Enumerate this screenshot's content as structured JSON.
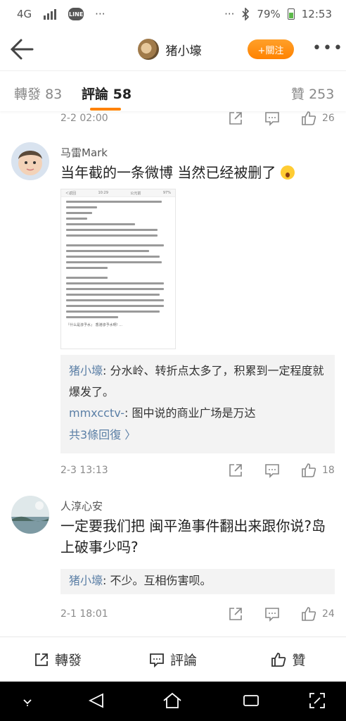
{
  "status_bar": {
    "network": "4G",
    "battery": "79%",
    "time": "12:53",
    "app_badge": "LINE",
    "more_dots": "···"
  },
  "header": {
    "title": "猪小壕",
    "follow_label": "+關注"
  },
  "tabs": [
    {
      "label": "轉發",
      "count": "83"
    },
    {
      "label": "評論",
      "count": "58"
    },
    {
      "label": "贊",
      "count": "253"
    }
  ],
  "top_meta": {
    "time": "2-2 02:00",
    "likes": "26"
  },
  "comments": [
    {
      "user": "马雷Mark",
      "text": "当年截的一条微博 当然已经被删了",
      "image": {
        "back_label": "＜返回",
        "account": "公元前",
        "clock": "10:29",
        "battery": "97%",
        "footer": "『什么是渗予水』 香港渗予水啊!  ..."
      },
      "replies": [
        {
          "name": "猪小壕",
          "text": ": 分水岭、转折点太多了，积累到一定程度就爆发了。"
        },
        {
          "name": "mmxcctv-",
          "text": ": 图中说的商业广场是万达"
        }
      ],
      "more_replies": "共3條回復 〉",
      "time": "2-3 13:13",
      "likes": "18"
    },
    {
      "user": "人淳心安",
      "text": "一定要我们把 闽平渔事件翻出来跟你说?岛上破事少吗?",
      "replies": [
        {
          "name": "猪小壕",
          "text": ": 不少。互相伤害呗。"
        }
      ],
      "time": "2-1 18:01",
      "likes": "24"
    }
  ],
  "bottom_bar": {
    "repost": "轉發",
    "comment": "評論",
    "like": "贊"
  }
}
